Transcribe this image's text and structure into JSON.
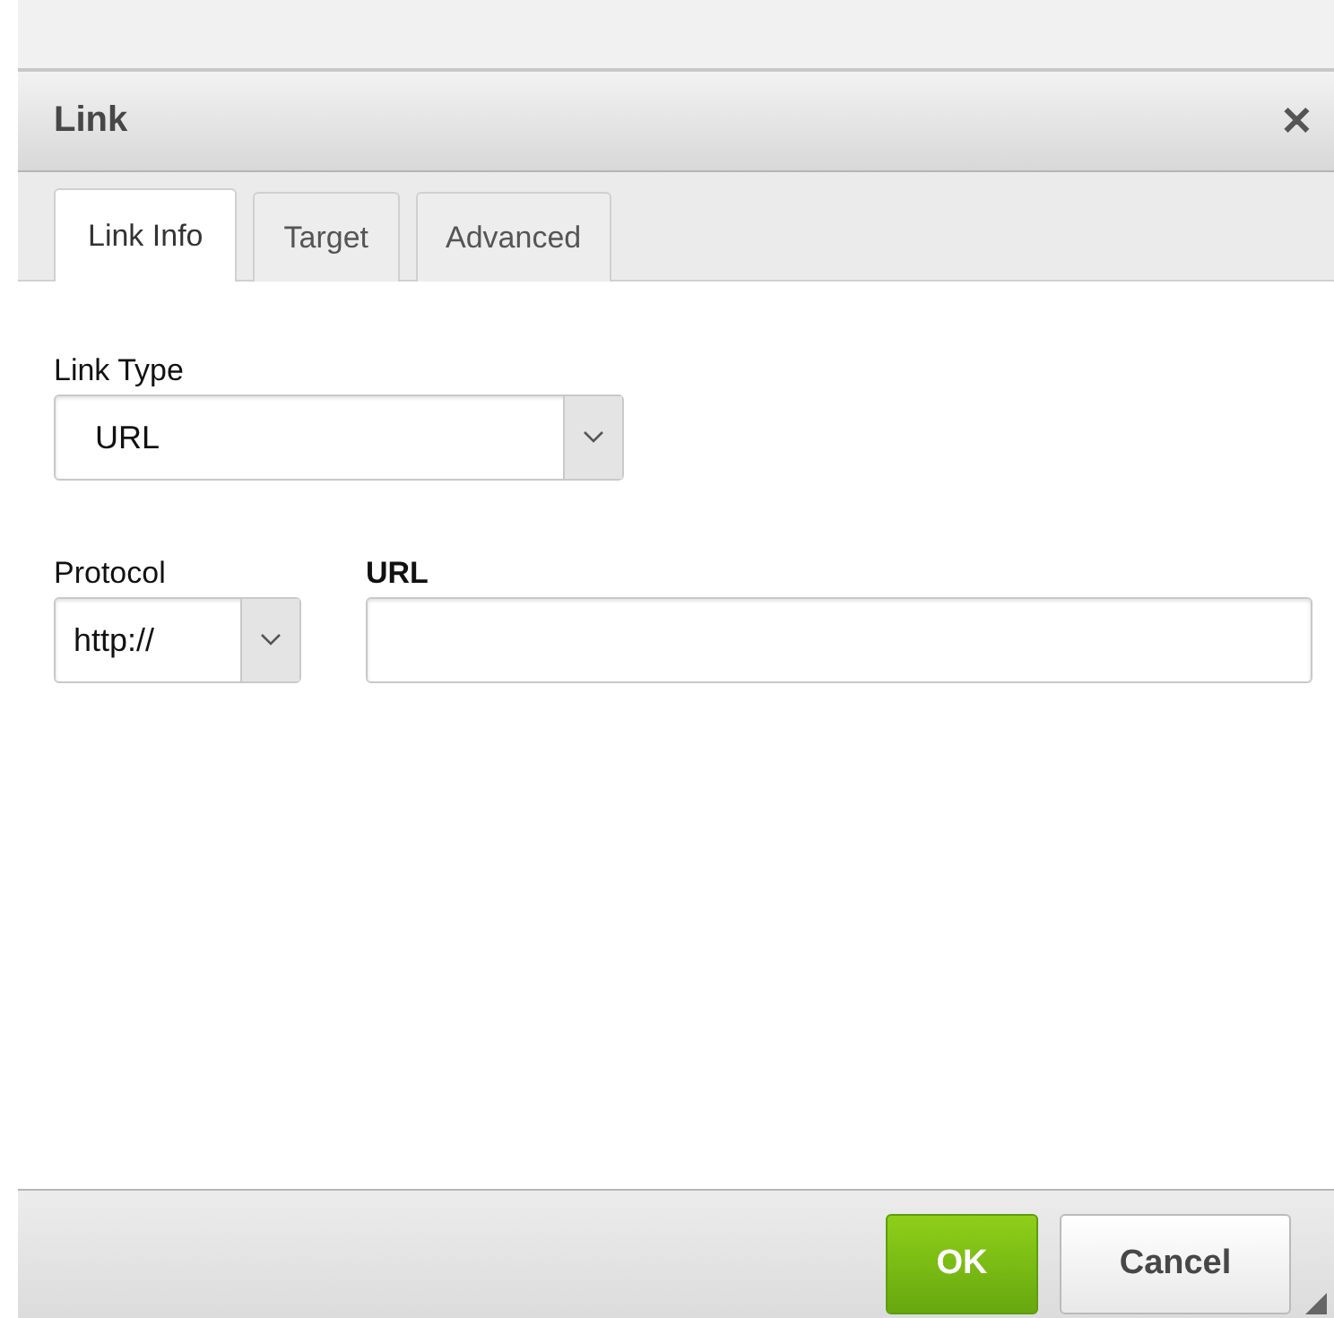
{
  "dialog": {
    "title": "Link",
    "close": "✕"
  },
  "tabs": [
    {
      "label": "Link Info",
      "selected": true
    },
    {
      "label": "Target",
      "selected": false
    },
    {
      "label": "Advanced",
      "selected": false
    }
  ],
  "link_type": {
    "label": "Link Type",
    "value": "URL"
  },
  "protocol": {
    "label": "Protocol",
    "value": "http://"
  },
  "url": {
    "label": "URL"
  },
  "buttons": [
    {
      "label": "OK",
      "kind": "primary"
    },
    {
      "label": "Cancel",
      "kind": "secondary"
    }
  ]
}
